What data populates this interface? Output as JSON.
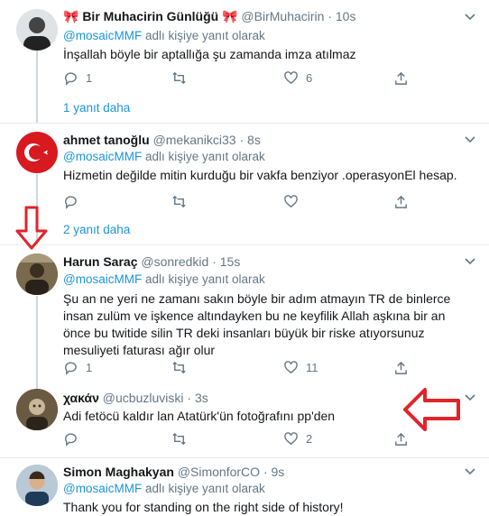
{
  "colors": {
    "accent": "#1b95e0",
    "muted": "#657786",
    "thread": "#ccd6dd",
    "arrow": "#e0242a"
  },
  "tweets": [
    {
      "name": "🎀 Bir Muhacirin Günlüğü 🎀",
      "handle": "@BirMuhacirin",
      "time": "10s",
      "reply_prefix": "@mosaicMMF",
      "reply_suffix": "adlı kişiye yanıt olarak",
      "text": "İnşallah böyle bir aptallığa şu zamanda imza atılmaz",
      "replies": "1",
      "retweets": "",
      "likes": "6",
      "more": "1 yanıt daha"
    },
    {
      "name": "ahmet tanoğlu",
      "handle": "@mekanikci33",
      "time": "8s",
      "reply_prefix": "@mosaicMMF",
      "reply_suffix": "adlı kişiye yanıt olarak",
      "text": "Hizmetin değilde mitin kurduğu bir vakfa benziyor .operasyonEl hesap.",
      "replies": "",
      "retweets": "",
      "likes": "",
      "more": "2 yanıt daha"
    },
    {
      "name": "Harun Saraç",
      "handle": "@sonredkid",
      "time": "15s",
      "reply_prefix": "@mosaicMMF",
      "reply_suffix": "adlı kişiye yanıt olarak",
      "text": "Şu an ne yeri ne zamanı sakın böyle bir adım atmayın TR de binlerce insan zulüm ve işkence altındayken bu ne keyfilik Allah aşkına bir an önce bu twitide silin TR deki insanları büyük bir riske atıyorsunuz mesuliyeti faturası ağır olur",
      "replies": "1",
      "retweets": "",
      "likes": "11"
    },
    {
      "name": "χακάν",
      "handle": "@ucbuzluviski",
      "time": "3s",
      "text": "Adi fetöcü kaldır lan Atatürk'ün fotoğrafını pp'den",
      "replies": "",
      "retweets": "",
      "likes": "2"
    },
    {
      "name": "Simon Maghakyan",
      "handle": "@SimonforCO",
      "time": "9s",
      "reply_prefix": "@mosaicMMF",
      "reply_suffix": "adlı kişiye yanıt olarak",
      "text": "Thank you for standing on the right side of history!"
    }
  ]
}
